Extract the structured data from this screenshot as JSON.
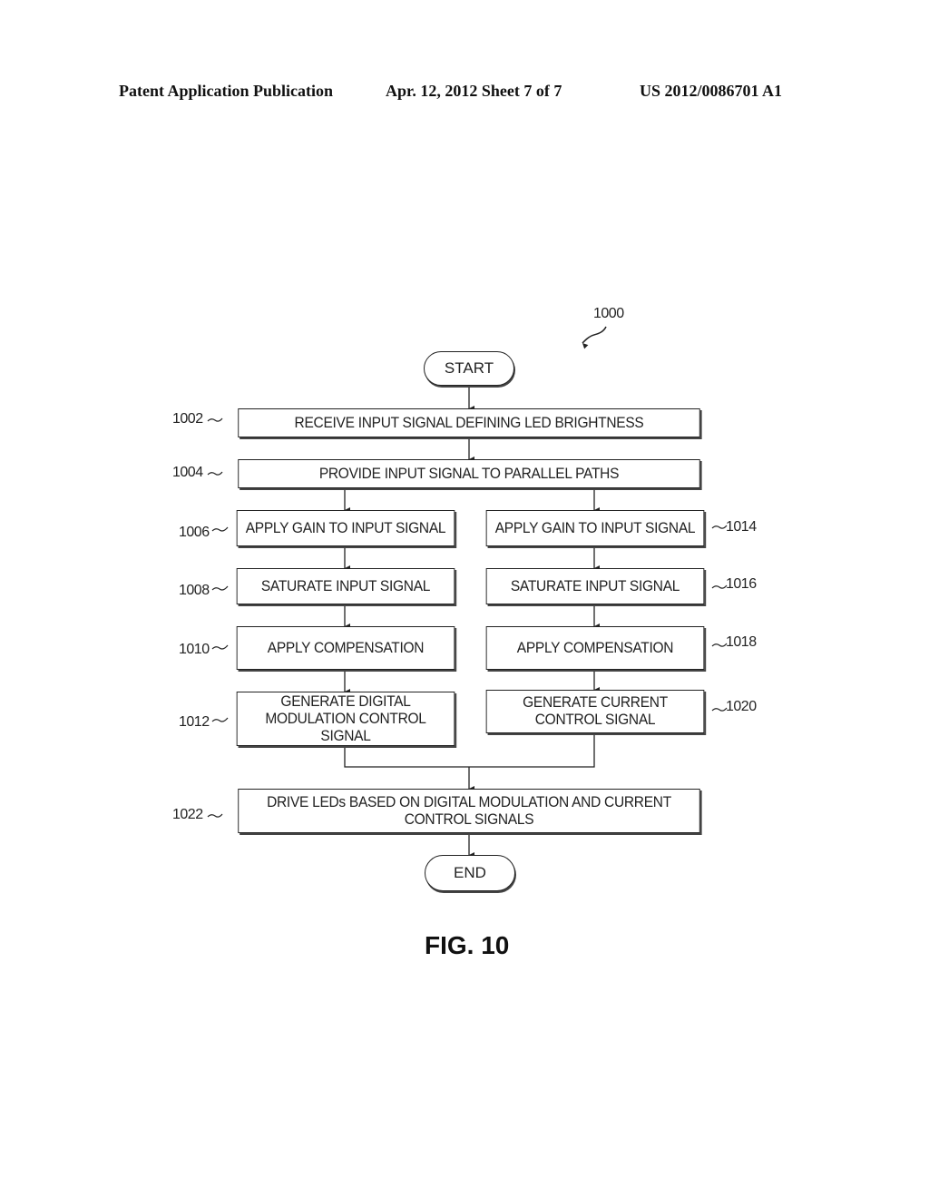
{
  "header": {
    "publication": "Patent Application Publication",
    "date_sheet": "Apr. 12, 2012  Sheet 7 of 7",
    "patent_number": "US 2012/0086701 A1"
  },
  "figure": {
    "reference": "1000",
    "caption": "FIG. 10"
  },
  "flowchart": {
    "start": "START",
    "end": "END",
    "steps": {
      "s1002": {
        "ref": "1002",
        "text": "RECEIVE INPUT SIGNAL DEFINING LED BRIGHTNESS"
      },
      "s1004": {
        "ref": "1004",
        "text": "PROVIDE INPUT SIGNAL TO PARALLEL PATHS"
      },
      "s1006": {
        "ref": "1006",
        "text": "APPLY GAIN TO INPUT SIGNAL"
      },
      "s1008": {
        "ref": "1008",
        "text": "SATURATE INPUT SIGNAL"
      },
      "s1010": {
        "ref": "1010",
        "text": "APPLY COMPENSATION"
      },
      "s1012": {
        "ref": "1012",
        "text": "GENERATE DIGITAL MODULATION CONTROL SIGNAL"
      },
      "s1014": {
        "ref": "1014",
        "text": "APPLY GAIN TO INPUT SIGNAL"
      },
      "s1016": {
        "ref": "1016",
        "text": "SATURATE INPUT SIGNAL"
      },
      "s1018": {
        "ref": "1018",
        "text": "APPLY COMPENSATION"
      },
      "s1020": {
        "ref": "1020",
        "text": "GENERATE CURRENT CONTROL SIGNAL"
      },
      "s1022": {
        "ref": "1022",
        "text": "DRIVE LEDs BASED ON DIGITAL MODULATION AND CURRENT CONTROL SIGNALS"
      }
    }
  }
}
